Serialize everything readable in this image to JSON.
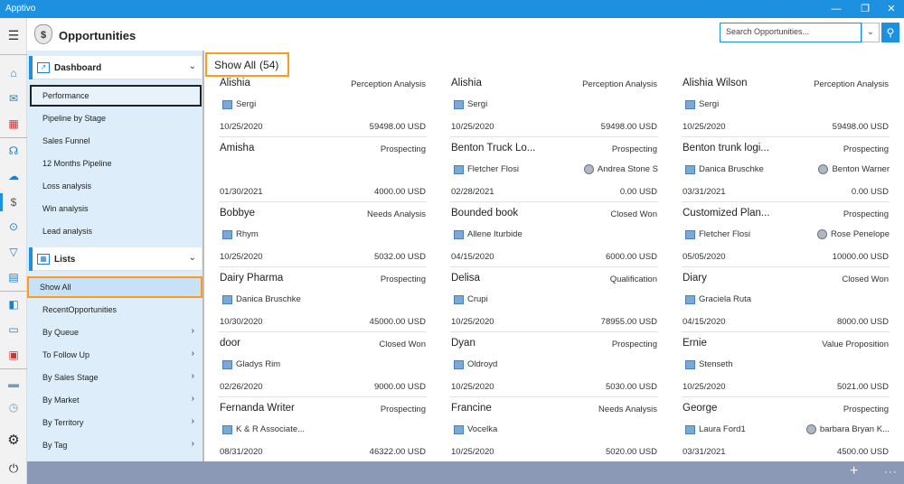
{
  "app": {
    "title": "Apptivo"
  },
  "window_controls": {
    "minimize": "—",
    "restore": "❐",
    "close": "✕"
  },
  "rail_icons": [
    "hamburger-icon",
    "home-icon",
    "mail-icon",
    "calculator-icon",
    "support-icon",
    "cloud-icon",
    "moneybag-icon",
    "dollar-icon",
    "funnel-icon",
    "document-icon",
    "bag-icon",
    "truck-icon",
    "cart-icon",
    "settings-icon",
    "power-icon"
  ],
  "header": {
    "title": "Opportunities",
    "search_placeholder": "Search Opportunities...",
    "search_icon": "search-icon"
  },
  "sidebar": {
    "dashboard_label": "Dashboard",
    "dashboard_items": [
      "Performance",
      "Pipeline by Stage",
      "Sales Funnel",
      "12 Months Pipeline",
      "Loss analysis",
      "Win analysis",
      "Lead analysis"
    ],
    "lists_label": "Lists",
    "list_items": [
      "Show All",
      "RecentOpportunities",
      "By Queue",
      "To Follow Up",
      "By Sales Stage",
      "By Market",
      "By Territory",
      "By Tag"
    ]
  },
  "list": {
    "title": "Show All",
    "count": "(54)"
  },
  "columns": [
    [
      {
        "name": "Alishia",
        "stage": "Perception Analysis",
        "contact": "Sergi",
        "assignee": "",
        "date": "10/25/2020",
        "amount": "59498.00 USD"
      },
      {
        "name": "Amisha",
        "stage": "Prospecting",
        "contact": "",
        "assignee": "",
        "date": "01/30/2021",
        "amount": "4000.00 USD"
      },
      {
        "name": "Bobbye",
        "stage": "Needs Analysis",
        "contact": "Rhym",
        "assignee": "",
        "date": "10/25/2020",
        "amount": "5032.00 USD"
      },
      {
        "name": "Dairy Pharma",
        "stage": "Prospecting",
        "contact": "Danica Bruschke",
        "assignee": "",
        "date": "10/30/2020",
        "amount": "45000.00 USD"
      },
      {
        "name": "door",
        "stage": "Closed Won",
        "contact": "Gladys Rim",
        "assignee": "",
        "date": "02/26/2020",
        "amount": "9000.00 USD"
      },
      {
        "name": "Fernanda Writer",
        "stage": "Prospecting",
        "contact": "K & R Associate...",
        "assignee": "",
        "date": "08/31/2020",
        "amount": "46322.00 USD"
      }
    ],
    [
      {
        "name": "Alishia",
        "stage": "Perception Analysis",
        "contact": "Sergi",
        "assignee": "",
        "date": "10/25/2020",
        "amount": "59498.00 USD"
      },
      {
        "name": "Benton Truck Lo...",
        "stage": "Prospecting",
        "contact": "Fletcher Flosi",
        "assignee": "Andrea Stone S",
        "date": "02/28/2021",
        "amount": "0.00 USD"
      },
      {
        "name": "Bounded book",
        "stage": "Closed Won",
        "contact": "Allene Iturbide",
        "assignee": "",
        "date": "04/15/2020",
        "amount": "6000.00 USD"
      },
      {
        "name": "Delisa",
        "stage": "Qualification",
        "contact": "Crupi",
        "assignee": "",
        "date": "10/25/2020",
        "amount": "78955.00 USD"
      },
      {
        "name": "Dyan",
        "stage": "Prospecting",
        "contact": "Oldroyd",
        "assignee": "",
        "date": "10/25/2020",
        "amount": "5030.00 USD"
      },
      {
        "name": "Francine",
        "stage": "Needs Analysis",
        "contact": "Vocelka",
        "assignee": "",
        "date": "10/25/2020",
        "amount": "5020.00 USD"
      }
    ],
    [
      {
        "name": "Alishia Wilson",
        "stage": "Perception Analysis",
        "contact": "Sergi",
        "assignee": "",
        "date": "10/25/2020",
        "amount": "59498.00 USD"
      },
      {
        "name": "Benton trunk logi...",
        "stage": "Prospecting",
        "contact": "Danica Bruschke",
        "assignee": "Benton Warner",
        "date": "03/31/2021",
        "amount": "0.00 USD"
      },
      {
        "name": "Customized Plan...",
        "stage": "Prospecting",
        "contact": "Fletcher Flosi",
        "assignee": "Rose Penelope",
        "date": "05/05/2020",
        "amount": "10000.00 USD"
      },
      {
        "name": "Diary",
        "stage": "Closed Won",
        "contact": "Graciela Ruta",
        "assignee": "",
        "date": "04/15/2020",
        "amount": "8000.00 USD"
      },
      {
        "name": "Ernie",
        "stage": "Value Proposition",
        "contact": "Stenseth",
        "assignee": "",
        "date": "10/25/2020",
        "amount": "5021.00 USD"
      },
      {
        "name": "George",
        "stage": "Prospecting",
        "contact": "Laura Ford1",
        "assignee": "barbara Bryan K...",
        "date": "03/31/2021",
        "amount": "4500.00 USD"
      }
    ]
  ],
  "bottom_bar": {
    "add": "+",
    "more": "···"
  },
  "colors": {
    "accent": "#1e90e0",
    "highlight": "#ff9a1f",
    "sidebar_bg": "#ddeefa",
    "bottom_bar": "#8b98b6"
  }
}
